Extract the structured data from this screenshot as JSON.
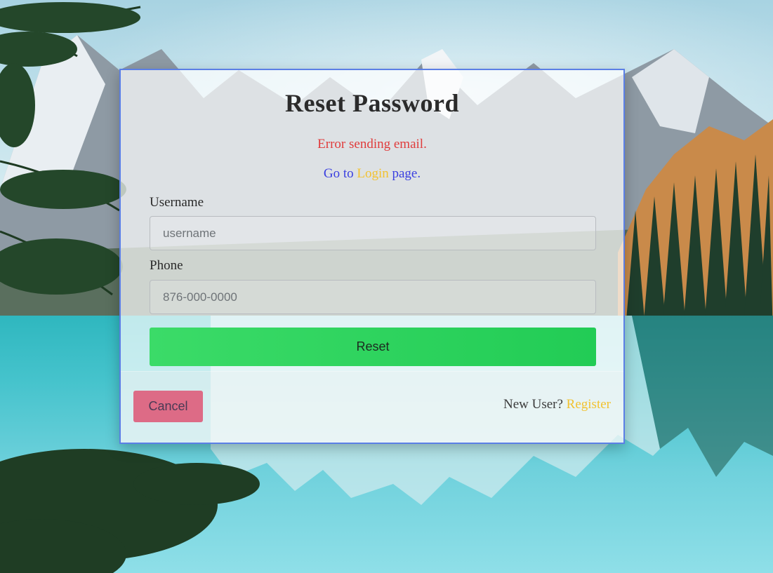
{
  "page": {
    "title": "Reset Password",
    "error_message": "Error sending email.",
    "goto_prefix": "Go to",
    "goto_link": "Login",
    "goto_suffix": "page."
  },
  "form": {
    "username_label": "Username",
    "username_placeholder": "username",
    "username_value": "",
    "phone_label": "Phone",
    "phone_placeholder": "876-000-0000",
    "phone_value": "",
    "reset_label": "Reset"
  },
  "footer": {
    "cancel_label": "Cancel",
    "new_user_text": "New User?",
    "register_link": "Register"
  },
  "colors": {
    "card_border": "#5b7fe6",
    "error": "#e03c3c",
    "link_blue": "#3a3fe0",
    "link_gold": "#f2c230",
    "reset_button": "#22cc55",
    "cancel_button": "#dd6b86"
  }
}
